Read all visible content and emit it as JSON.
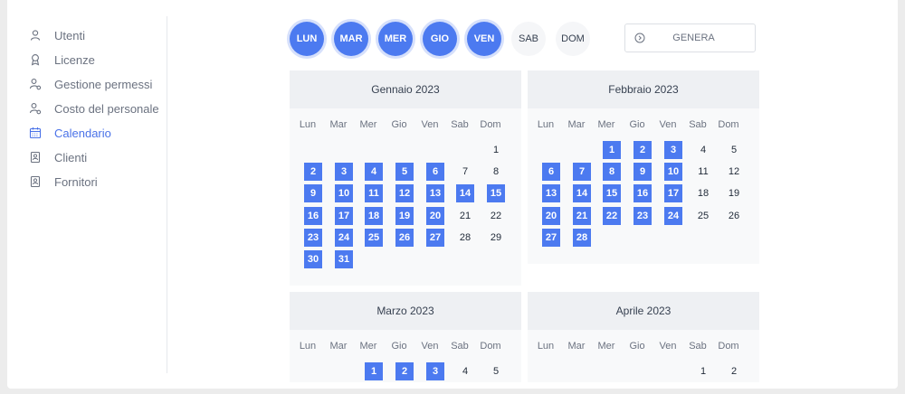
{
  "sidebar": {
    "items": [
      {
        "label": "Utenti",
        "icon": "user-icon",
        "active": false
      },
      {
        "label": "Licenze",
        "icon": "award-icon",
        "active": false
      },
      {
        "label": "Gestione permessi",
        "icon": "user-gear-icon",
        "active": false
      },
      {
        "label": "Costo del personale",
        "icon": "user-cost-icon",
        "active": false
      },
      {
        "label": "Calendario",
        "icon": "calendar-icon",
        "active": true
      },
      {
        "label": "Clienti",
        "icon": "contact-card-icon",
        "active": false
      },
      {
        "label": "Fornitori",
        "icon": "contact-card-icon",
        "active": false
      }
    ]
  },
  "weekday_toggles": [
    {
      "label": "LUN",
      "selected": true
    },
    {
      "label": "MAR",
      "selected": true
    },
    {
      "label": "MER",
      "selected": true
    },
    {
      "label": "GIO",
      "selected": true
    },
    {
      "label": "VEN",
      "selected": true
    },
    {
      "label": "SAB",
      "selected": false
    },
    {
      "label": "DOM",
      "selected": false
    }
  ],
  "genera": {
    "label": "GENERA",
    "icon": "arrow-circle-right-icon"
  },
  "weekday_headers": [
    "Lun",
    "Mar",
    "Mer",
    "Gio",
    "Ven",
    "Sab",
    "Dom"
  ],
  "colors": {
    "accent": "#4c7af0",
    "active_nav": "#4a72e8"
  },
  "months": [
    {
      "title": "Gennaio 2023",
      "weeks": [
        [
          "",
          "",
          "",
          "",
          "",
          "",
          "1"
        ],
        [
          "2",
          "3",
          "4",
          "5",
          "6",
          "7",
          "8"
        ],
        [
          "9",
          "10",
          "11",
          "12",
          "13",
          "14",
          "15"
        ],
        [
          "16",
          "17",
          "18",
          "19",
          "20",
          "21",
          "22"
        ],
        [
          "23",
          "24",
          "25",
          "26",
          "27",
          "28",
          "29"
        ],
        [
          "30",
          "31",
          "",
          "",
          "",
          "",
          ""
        ]
      ],
      "selected": [
        "2",
        "3",
        "4",
        "5",
        "6",
        "9",
        "10",
        "11",
        "12",
        "13",
        "14",
        "15",
        "16",
        "17",
        "18",
        "19",
        "20",
        "23",
        "24",
        "25",
        "26",
        "27",
        "30",
        "31"
      ]
    },
    {
      "title": "Febbraio 2023",
      "weeks": [
        [
          "",
          "",
          "1",
          "2",
          "3",
          "4",
          "5"
        ],
        [
          "6",
          "7",
          "8",
          "9",
          "10",
          "11",
          "12"
        ],
        [
          "13",
          "14",
          "15",
          "16",
          "17",
          "18",
          "19"
        ],
        [
          "20",
          "21",
          "22",
          "23",
          "24",
          "25",
          "26"
        ],
        [
          "27",
          "28",
          "",
          "",
          "",
          "",
          ""
        ]
      ],
      "selected": [
        "1",
        "2",
        "3",
        "6",
        "7",
        "8",
        "9",
        "10",
        "13",
        "14",
        "15",
        "16",
        "17",
        "20",
        "21",
        "22",
        "23",
        "24",
        "27",
        "28"
      ]
    },
    {
      "title": "Marzo 2023",
      "weeks": [
        [
          "",
          "",
          "1",
          "2",
          "3",
          "4",
          "5"
        ]
      ],
      "selected": [
        "1",
        "2",
        "3"
      ]
    },
    {
      "title": "Aprile 2023",
      "weeks": [
        [
          "",
          "",
          "",
          "",
          "",
          "1",
          "2"
        ]
      ],
      "selected": []
    }
  ]
}
